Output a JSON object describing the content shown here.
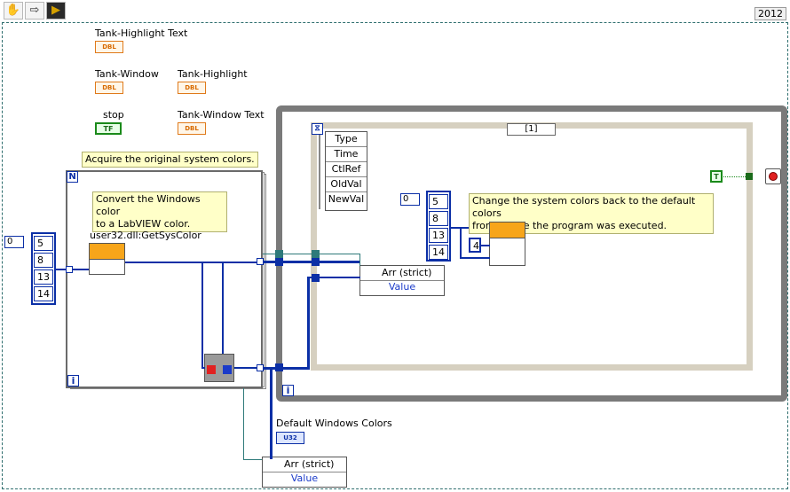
{
  "toolbar": {
    "year": "2012",
    "icons": [
      "hand-icon",
      "arrow-icon",
      "run-icon"
    ]
  },
  "labels": {
    "tank_highlight_text": "Tank-Highlight Text",
    "tank_window": "Tank-Window",
    "tank_highlight": "Tank-Highlight",
    "stop": "stop",
    "tank_window_text": "Tank-Window Text",
    "dll_name": "user32.dll:GetSysColor",
    "default_windows_colors": "Default Windows Colors"
  },
  "terminals": {
    "dbl": "DBL",
    "tf": "TF",
    "u32": "U32",
    "t": "T"
  },
  "comments": {
    "acquire": "Acquire the original system colors.",
    "convert_line1": "Convert the Windows color",
    "convert_line2": "to a LabVIEW color.",
    "change_line1": "Change the system colors back to the default colors",
    "change_line2": "from before the program was executed."
  },
  "arrays": {
    "left_index": "0",
    "left_values": [
      "5",
      "8",
      "13",
      "14"
    ],
    "inner_index": "0",
    "inner_values": [
      "5",
      "8",
      "13",
      "14"
    ],
    "const_four": "4"
  },
  "loop": {
    "n_label": "N",
    "info_label": "i"
  },
  "case": {
    "selector": "[1]",
    "event_fields": [
      "Type",
      "Time",
      "CtlRef",
      "OldVal",
      "NewVal"
    ]
  },
  "property_nodes": {
    "top_arr": "Arr (strict)",
    "top_value": "Value",
    "bottom_arr": "Arr (strict)",
    "bottom_value": "Value"
  }
}
